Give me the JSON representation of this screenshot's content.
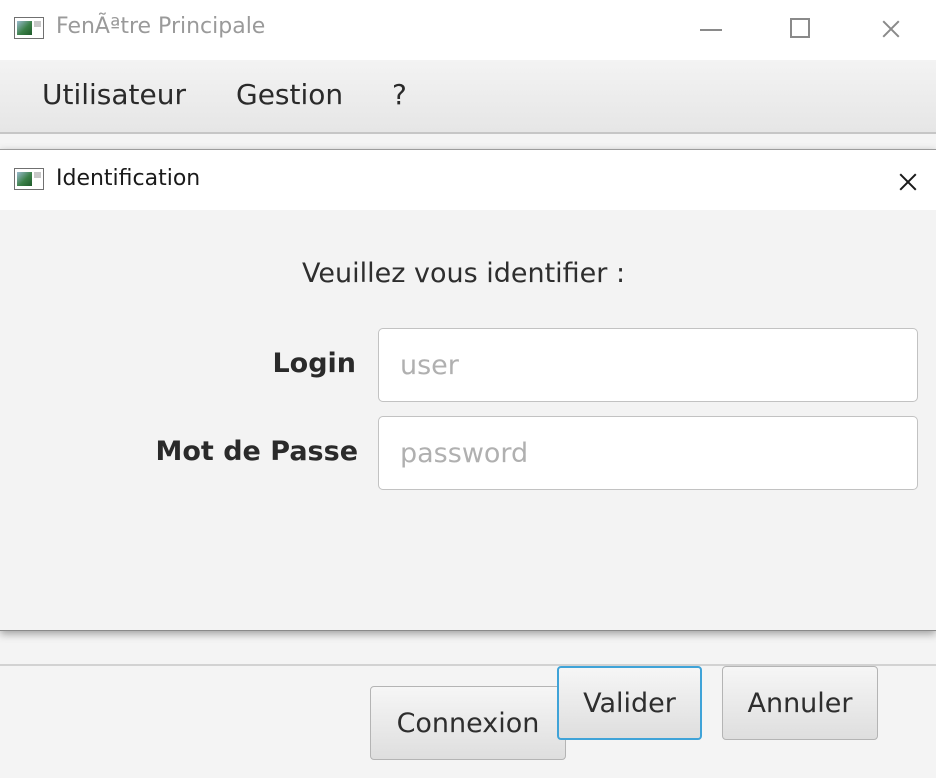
{
  "main_window": {
    "title": "FenÃªtre Principale",
    "menu": [
      "Utilisateur",
      "Gestion",
      "?"
    ],
    "connect_button": "Connexion"
  },
  "dialog": {
    "title": "Identification",
    "prompt": "Veuillez vous identifier :",
    "login_label": "Login",
    "login_placeholder": "user",
    "login_value": "",
    "password_label": "Mot de Passe",
    "password_placeholder": "password",
    "password_value": "",
    "ok_button": "Valider",
    "cancel_button": "Annuler"
  },
  "colors": {
    "focus_border": "#3fa3d8",
    "background": "#f4f4f4",
    "titlebar": "#ffffff"
  }
}
